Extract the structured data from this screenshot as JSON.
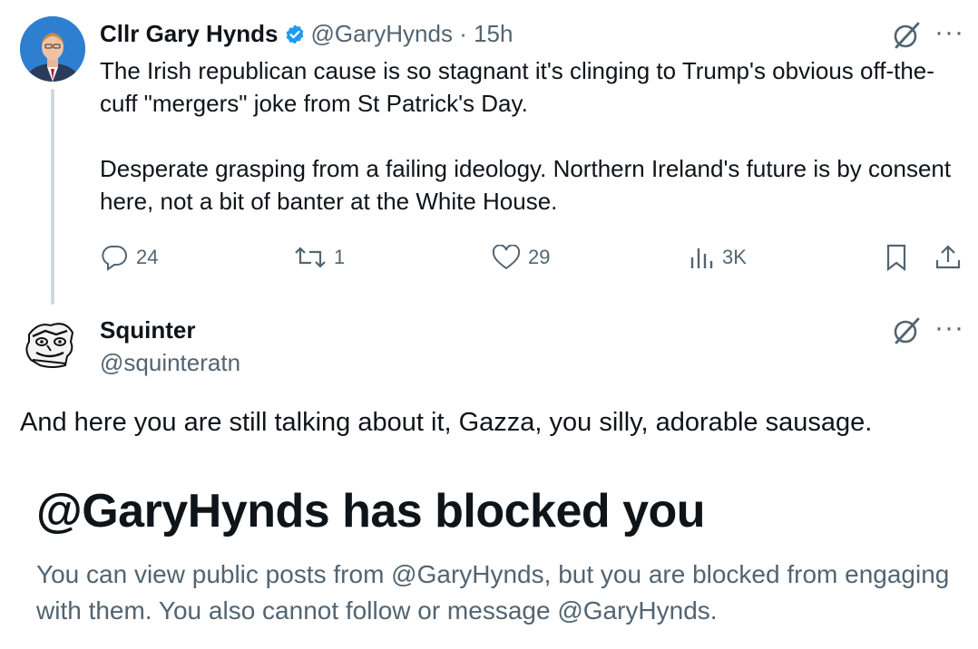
{
  "tweet1": {
    "author_name": "Cllr Gary Hynds",
    "handle": "@GaryHynds",
    "separator": "·",
    "time": "15h",
    "paragraphs": [
      "The Irish republican cause is so stagnant it's clinging to Trump's obvious off-the-cuff \"mergers\" joke from St Patrick's Day.",
      "Desperate grasping from a failing ideology. Northern Ireland's future is by consent here, not a bit of banter at the White House."
    ],
    "replies": "24",
    "reposts": "1",
    "likes": "29",
    "views": "3K",
    "more": "···"
  },
  "tweet2": {
    "author_name": "Squinter",
    "handle": "@squinteratn",
    "text": "And here you are still talking about it, Gazza, you silly, adorable sausage.",
    "more": "···"
  },
  "notice": {
    "title": "@GaryHynds has blocked you",
    "description": "You can view public posts from @GaryHynds, but you are blocked from engaging with them. You also cannot follow or message @GaryHynds."
  },
  "colors": {
    "text": "#0f1419",
    "secondary": "#536471",
    "verified": "#1d9bf0",
    "thread_line": "#cfd9de"
  }
}
